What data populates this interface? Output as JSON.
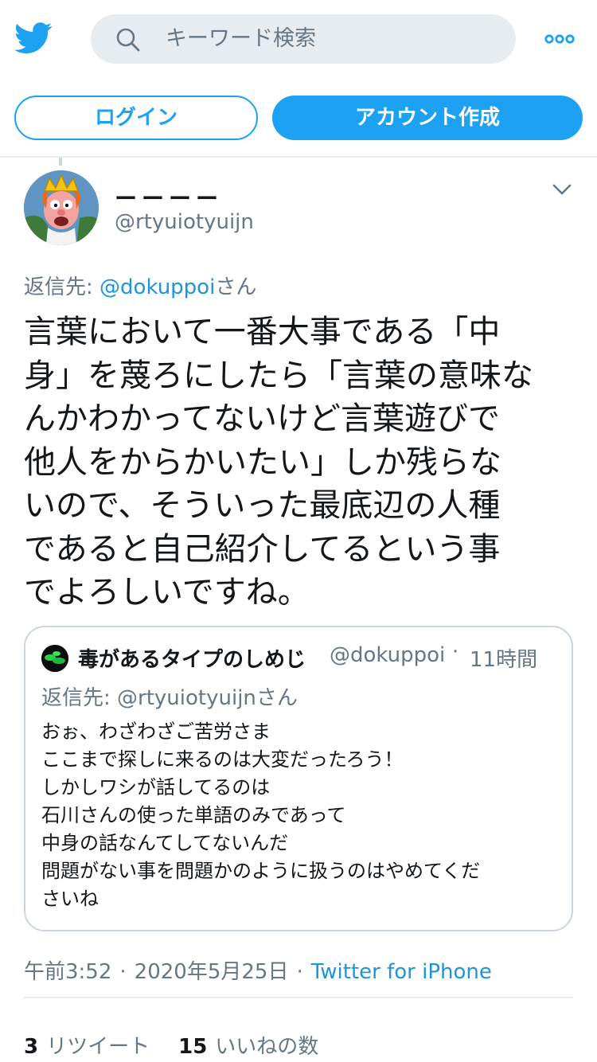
{
  "colors": {
    "brand": "#1da1f2",
    "link": "#1b95e0",
    "muted": "#657786",
    "text": "#14171a"
  },
  "header": {
    "logo_icon": "twitter-bird-icon",
    "search_placeholder": "キーワード検索",
    "more_icon": "more-dots-icon"
  },
  "auth": {
    "login_label": "ログイン",
    "signup_label": "アカウント作成"
  },
  "tweet": {
    "author_name": "ーーーー",
    "author_handle": "@rtyuiotyuijn",
    "reply_prefix": "返信先: ",
    "reply_mention": "@dokuppoi",
    "reply_suffix": "さん",
    "text": "言葉において一番大事である「中\n身」を蔑ろにしたら「言葉の意味な\nんかわかってないけど言葉遊びで\n他人をからかいたい」しか残らな\nいので、そういった最底辺の人種\nであると自己紹介してるという事\nでよろしいですね。",
    "time": "午前3:52",
    "date": "2020年5月25日",
    "source": "Twitter for iPhone",
    "retweet_count": "3",
    "retweet_label": "リツイート",
    "like_count": "15",
    "like_label": "いいねの数"
  },
  "quote": {
    "author_name": "毒があるタイプのしめじ",
    "author_handle": "@dokuppoi",
    "time": "11時間",
    "reply_line": "返信先: @rtyuiotyuijnさん",
    "text": "おぉ、わざわざご苦労さま\nここまで探しに来るのは大変だったろう！\nしかしワシが話してるのは\n石川さんの使った単語のみであって\n中身の話なんてしてないんだ\n問題がない事を問題かのように扱うのはやめてくだ\nさいね"
  }
}
